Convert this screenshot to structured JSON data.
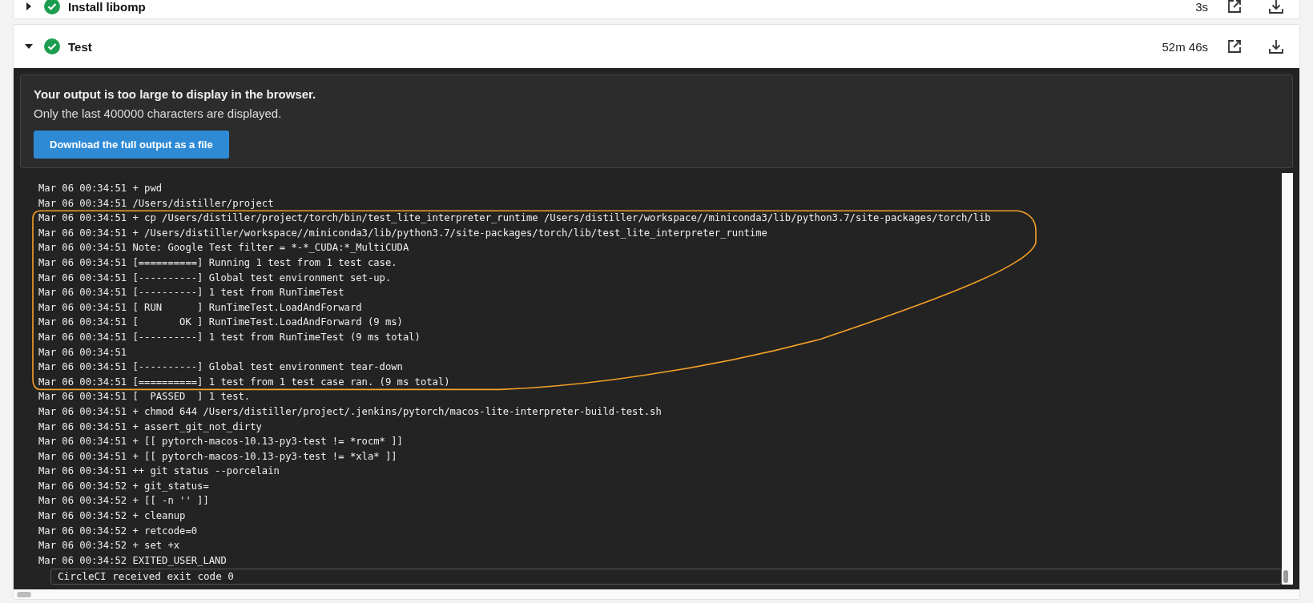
{
  "steps": [
    {
      "name": "Install libomp",
      "passed": true,
      "expanded": false,
      "duration": "3s"
    },
    {
      "name": "Test",
      "passed": true,
      "expanded": true,
      "duration": "52m 46s",
      "notice": {
        "title": "Your output is too large to display in the browser.",
        "message": "Only the last 400000 characters are displayed.",
        "button": "Download the full output as a file"
      },
      "log": [
        "Mar 06 00:34:51 + pwd",
        "Mar 06 00:34:51 /Users/distiller/project",
        "Mar 06 00:34:51 + cp /Users/distiller/project/torch/bin/test_lite_interpreter_runtime /Users/distiller/workspace//miniconda3/lib/python3.7/site-packages/torch/lib",
        "Mar 06 00:34:51 + /Users/distiller/workspace//miniconda3/lib/python3.7/site-packages/torch/lib/test_lite_interpreter_runtime",
        "Mar 06 00:34:51 Note: Google Test filter = *-*_CUDA:*_MultiCUDA",
        "Mar 06 00:34:51 [==========] Running 1 test from 1 test case.",
        "Mar 06 00:34:51 [----------] Global test environment set-up.",
        "Mar 06 00:34:51 [----------] 1 test from RunTimeTest",
        "Mar 06 00:34:51 [ RUN      ] RunTimeTest.LoadAndForward",
        "Mar 06 00:34:51 [       OK ] RunTimeTest.LoadAndForward (9 ms)",
        "Mar 06 00:34:51 [----------] 1 test from RunTimeTest (9 ms total)",
        "Mar 06 00:34:51",
        "Mar 06 00:34:51 [----------] Global test environment tear-down",
        "Mar 06 00:34:51 [==========] 1 test from 1 test case ran. (9 ms total)",
        "Mar 06 00:34:51 [  PASSED  ] 1 test.",
        "Mar 06 00:34:51 + chmod 644 /Users/distiller/project/.jenkins/pytorch/macos-lite-interpreter-build-test.sh",
        "Mar 06 00:34:51 + assert_git_not_dirty",
        "Mar 06 00:34:51 + [[ pytorch-macos-10.13-py3-test != *rocm* ]]",
        "Mar 06 00:34:51 + [[ pytorch-macos-10.13-py3-test != *xla* ]]",
        "Mar 06 00:34:51 ++ git status --porcelain",
        "Mar 06 00:34:52 + git_status=",
        "Mar 06 00:34:52 + [[ -n '' ]]",
        "Mar 06 00:34:52 + cleanup",
        "Mar 06 00:34:52 + retcode=0",
        "Mar 06 00:34:52 + set +x",
        "Mar 06 00:34:52 EXITED_USER_LAND"
      ],
      "exit_line": "CircleCI received exit code 0"
    }
  ]
}
